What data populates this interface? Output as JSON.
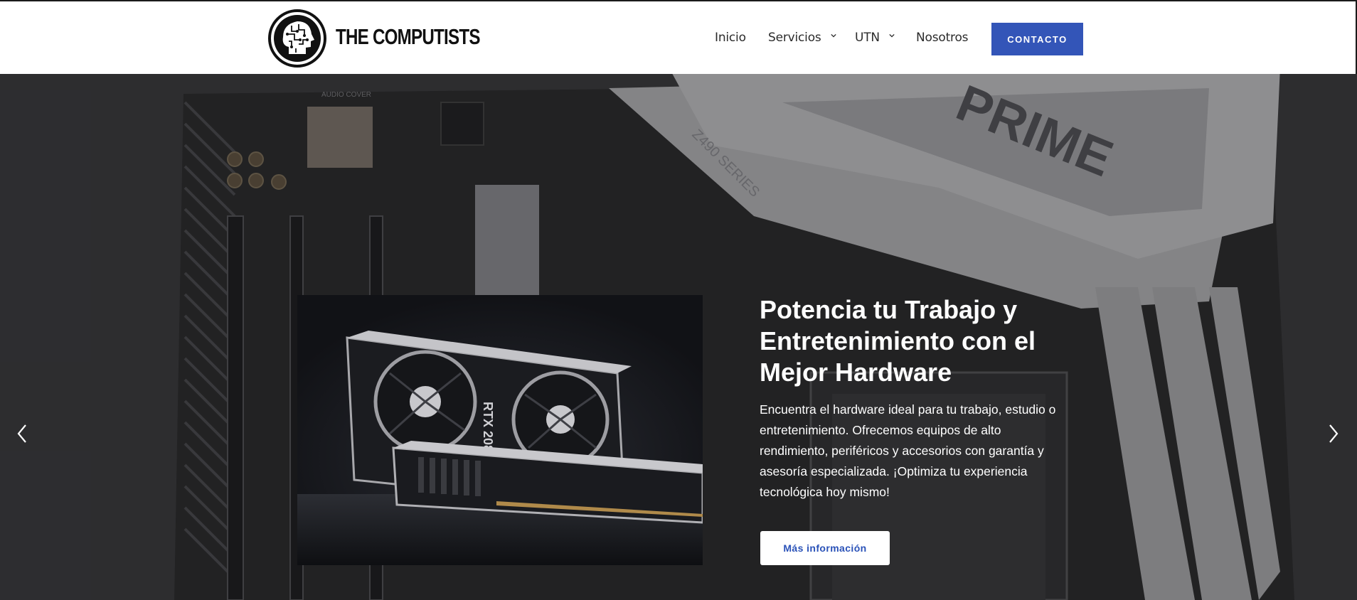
{
  "brand": {
    "name": "THE COMPUTISTS",
    "logo_icon": "circuit-brain-head-icon"
  },
  "nav": {
    "items": [
      {
        "label": "Inicio",
        "has_dropdown": false
      },
      {
        "label": "Servicios",
        "has_dropdown": true
      },
      {
        "label": "UTN",
        "has_dropdown": true
      },
      {
        "label": "Nosotros",
        "has_dropdown": false
      }
    ],
    "cta_label": "CONTACTO"
  },
  "hero": {
    "title": "Potencia tu Trabajo y Entretenimiento con el Mejor Hardware",
    "description": "Encuentra el hardware ideal para tu trabajo, estudio o entretenimiento. Ofrecemos equipos de alto rendimiento, periféricos y accesorios con garantía y asesoría especializada. ¡Optimiza tu experiencia tecnológica hoy mismo!",
    "button_label": "Más información",
    "bg_board_text": "PRIME",
    "bg_series_text": "Z490 SERIES",
    "gpu_text": "RTX 2080",
    "prev_icon": "chevron-left-icon",
    "next_icon": "chevron-right-icon"
  },
  "colors": {
    "accent": "#3355b8",
    "button_text": "#2a52b8",
    "header_bg": "#ffffff",
    "hero_overlay": "#2b2b2d"
  }
}
